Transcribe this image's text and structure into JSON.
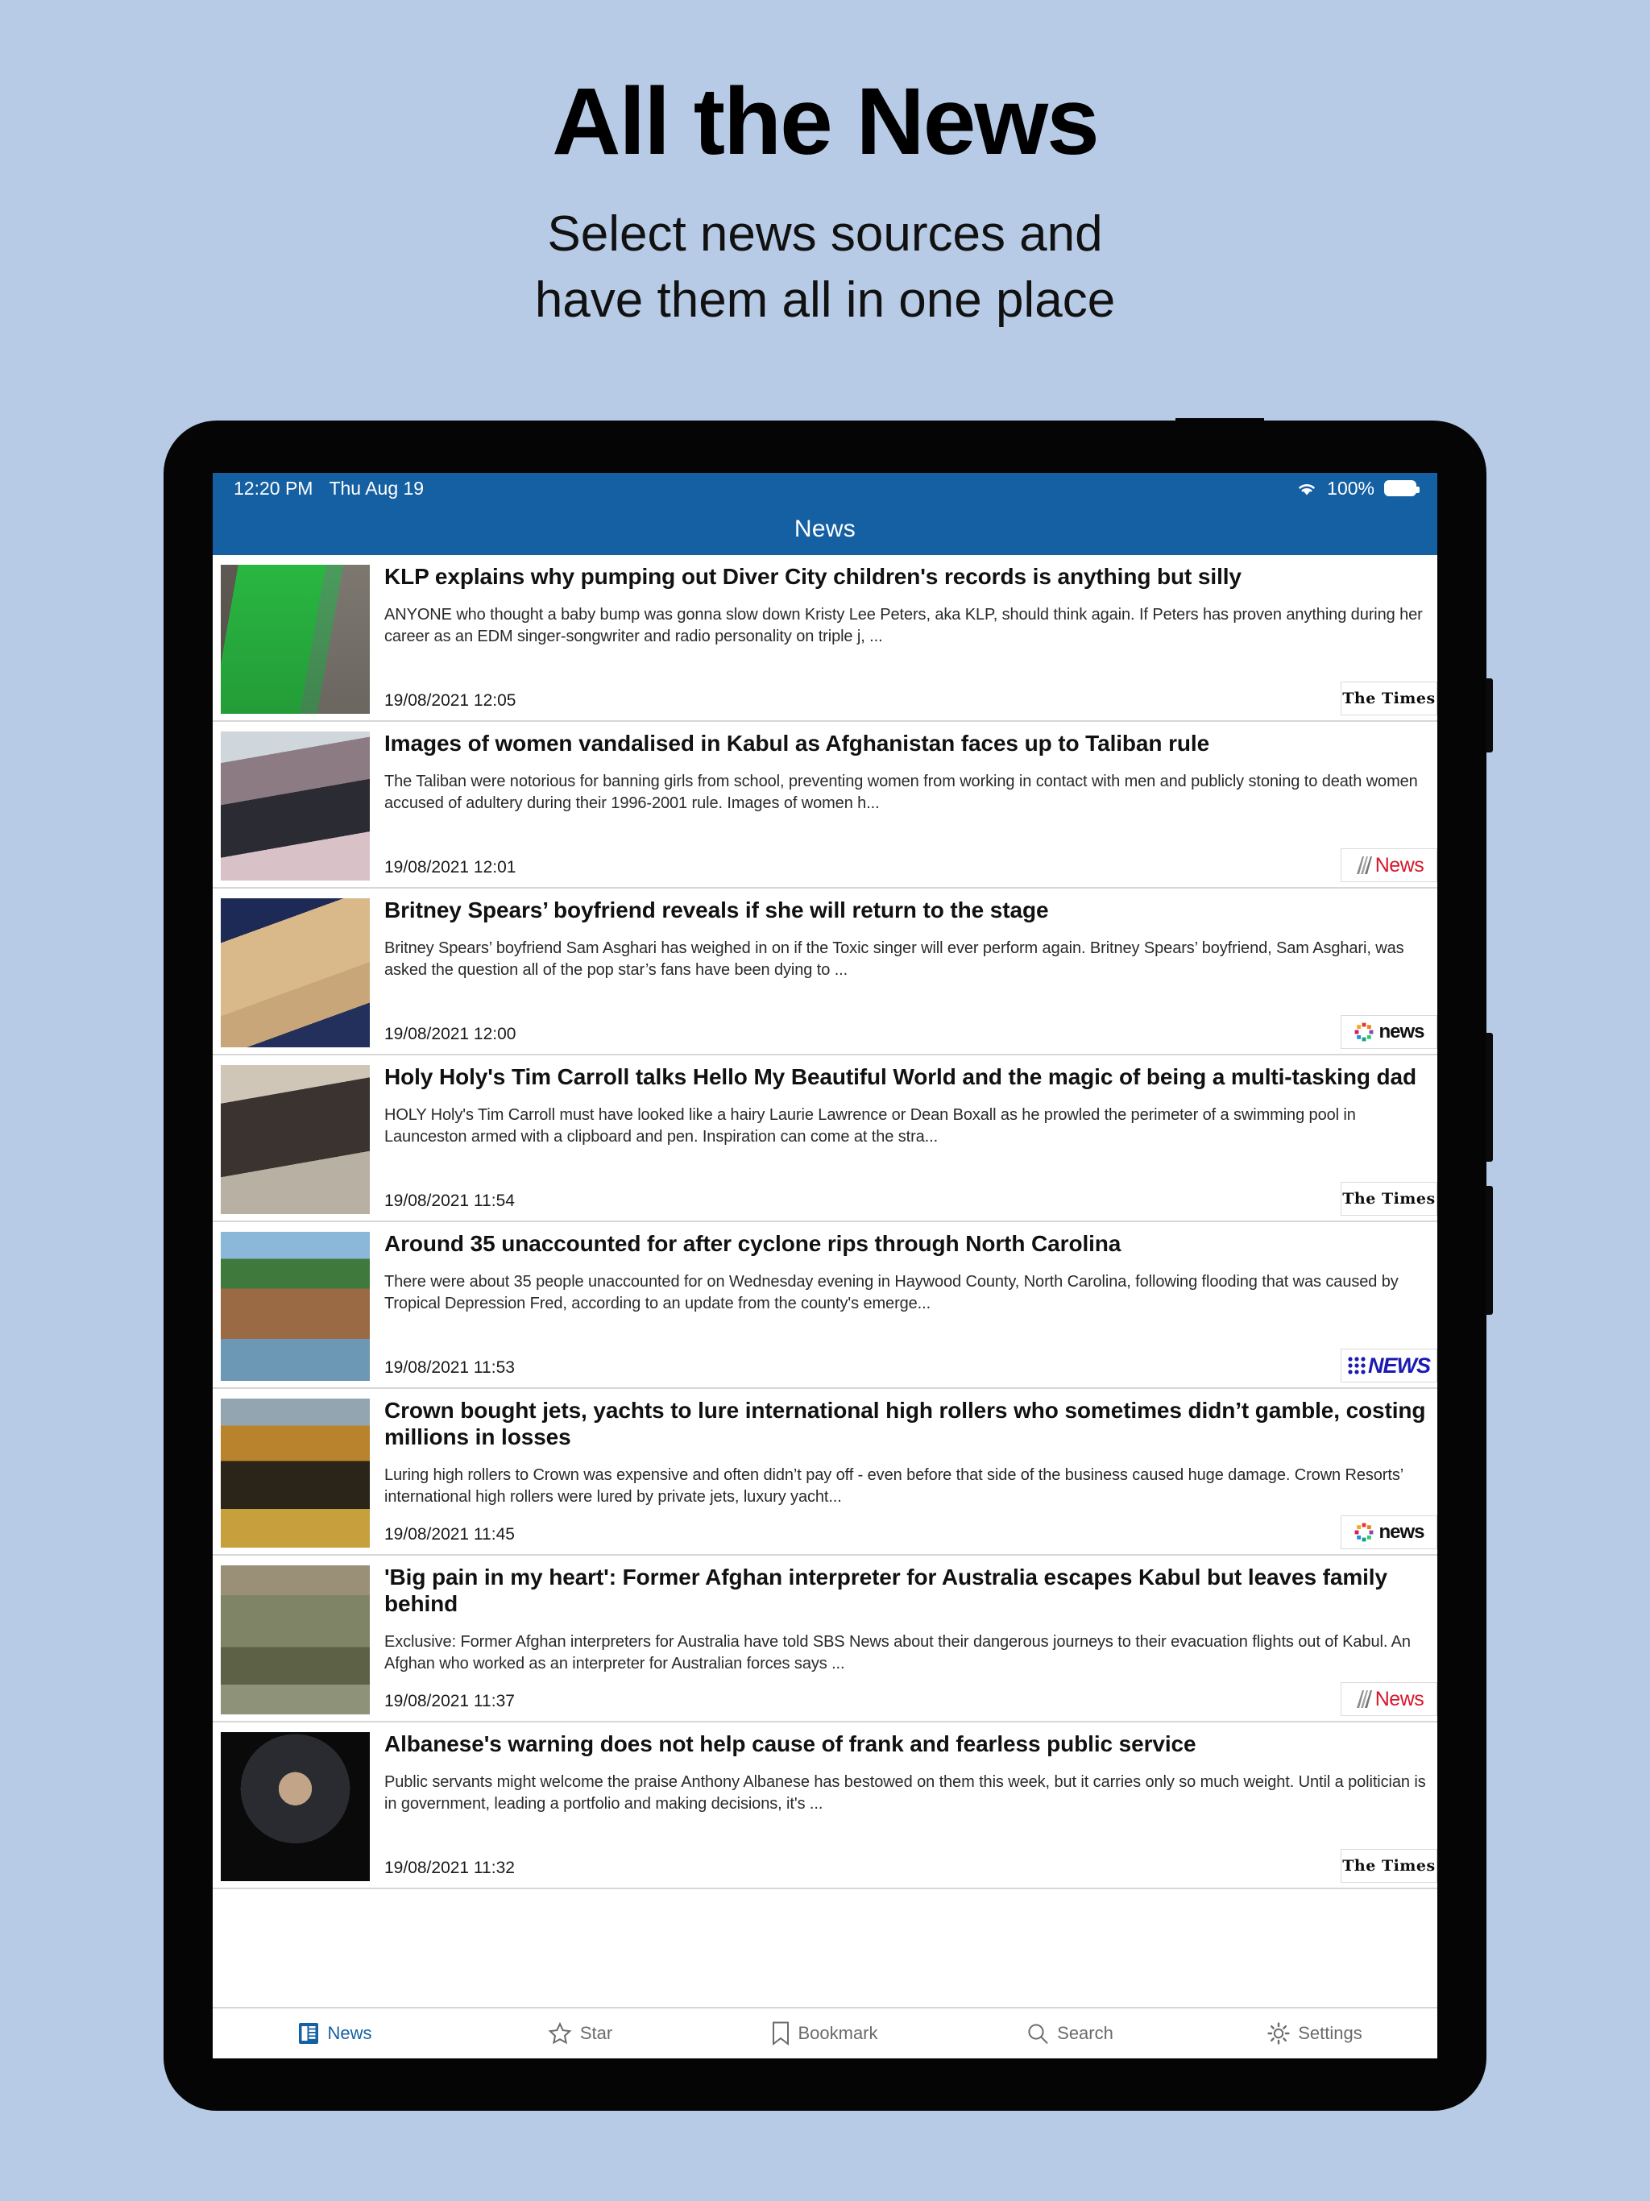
{
  "promo": {
    "title": "All the News",
    "subtitle_line1": "Select news sources and",
    "subtitle_line2": "have them all in one place"
  },
  "colors": {
    "page_background": "#b7cbe6",
    "header_blue": "#1560a3",
    "accent_active": "#1560a3",
    "device_frame": "#050505"
  },
  "statusbar": {
    "time": "12:20 PM",
    "date": "Thu Aug 19",
    "wifi_icon": "wifi-icon",
    "battery_percent": "100%",
    "battery_icon": "battery-full-icon"
  },
  "navbar": {
    "title": "News"
  },
  "articles": [
    {
      "headline": "KLP explains why pumping out Diver City children's records is anything but silly",
      "summary": "ANYONE who thought a baby bump was gonna slow down Kristy Lee Peters, aka KLP, should think again. If Peters has proven anything during her career as an EDM singer-songwriter and radio personality on triple j, ...",
      "timestamp": "19/08/2021 12:05",
      "source": "The Times",
      "source_logo": "the-times-logo",
      "thumb_class": "t1"
    },
    {
      "headline": "Images of women vandalised in Kabul as Afghanistan faces up to Taliban rule",
      "summary": "The Taliban were notorious for banning girls from school, preventing women from working in contact with men and publicly stoning to death women accused of adultery during their 1996-2001 rule. Images of women h...",
      "timestamp": "19/08/2021 12:01",
      "source": "SBS News",
      "source_logo": "sbs-news-logo",
      "thumb_class": "t2"
    },
    {
      "headline": "Britney Spears’ boyfriend reveals if she will return to the stage",
      "summary": "Britney Spears’ boyfriend Sam Asghari has weighed in on if the Toxic singer will ever perform again. Britney Spears’ boyfriend, Sam Asghari, was asked the question all of the pop star’s fans have been dying to ...",
      "timestamp": "19/08/2021 12:00",
      "source": "news",
      "source_logo": "news-com-au-logo",
      "thumb_class": "t3"
    },
    {
      "headline": "Holy Holy's Tim Carroll talks Hello My Beautiful World and the magic of being a multi-tasking dad",
      "summary": "HOLY Holy's Tim Carroll must have looked like a hairy Laurie Lawrence or Dean Boxall as he prowled the perimeter of a swimming pool in Launceston armed with a clipboard and pen. Inspiration can come at the stra...",
      "timestamp": "19/08/2021 11:54",
      "source": "The Times",
      "source_logo": "the-times-logo",
      "thumb_class": "t4"
    },
    {
      "headline": "Around 35 unaccounted for after cyclone rips through North Carolina",
      "summary": "There were about 35 people unaccounted for on Wednesday evening in Haywood County, North Carolina, following flooding that was caused by Tropical Depression Fred, according to an update from the county's emerge...",
      "timestamp": "19/08/2021 11:53",
      "source": "NEWS",
      "source_logo": "nine-news-logo",
      "thumb_class": "t5"
    },
    {
      "headline": "Crown bought jets, yachts to lure international high rollers who sometimes didn’t gamble, costing millions in losses",
      "summary": "Luring high rollers to Crown was expensive and often didn’t pay off - even before that side of the business caused huge damage. Crown Resorts’ international high rollers were lured by private jets, luxury yacht...",
      "timestamp": "19/08/2021 11:45",
      "source": "news",
      "source_logo": "news-com-au-logo",
      "thumb_class": "t6"
    },
    {
      "headline": "'Big pain in my heart': Former Afghan interpreter for Australia escapes Kabul but leaves family behind",
      "summary": "Exclusive: Former Afghan interpreters for Australia have told SBS News about their dangerous journeys to their evacuation flights out of Kabul. An Afghan who worked as an interpreter for Australian forces says ...",
      "timestamp": "19/08/2021 11:37",
      "source": "SBS News",
      "source_logo": "sbs-news-logo",
      "thumb_class": "t7"
    },
    {
      "headline": "Albanese's warning does not help cause of frank and fearless public service",
      "summary": "Public servants might welcome the praise Anthony Albanese has bestowed on them this week, but it carries only so much weight. Until a politician is in government, leading a portfolio and making decisions, it's ...",
      "timestamp": "19/08/2021 11:32",
      "source": "The Times",
      "source_logo": "the-times-logo",
      "thumb_class": "t8"
    }
  ],
  "tabbar": {
    "items": [
      {
        "label": "News",
        "icon": "news-icon",
        "active": true
      },
      {
        "label": "Star",
        "icon": "star-icon",
        "active": false
      },
      {
        "label": "Bookmark",
        "icon": "bookmark-icon",
        "active": false
      },
      {
        "label": "Search",
        "icon": "search-icon",
        "active": false
      },
      {
        "label": "Settings",
        "icon": "gear-icon",
        "active": false
      }
    ]
  }
}
